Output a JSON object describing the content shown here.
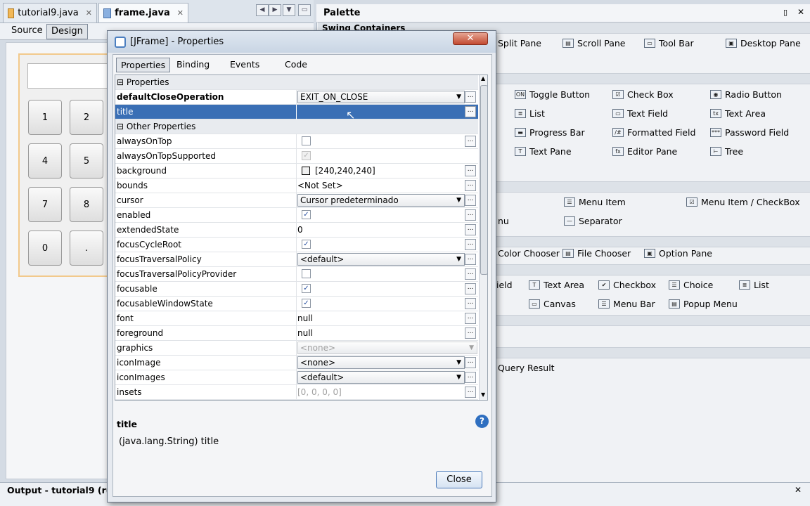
{
  "editor": {
    "tabs": [
      {
        "label": "tutorial9.java"
      },
      {
        "label": "frame.java"
      }
    ],
    "source_label": "Source",
    "design_label": "Design"
  },
  "calculator": {
    "buttons": [
      "1",
      "2",
      "4",
      "5",
      "7",
      "8",
      "0",
      "."
    ]
  },
  "palette": {
    "title": "Palette",
    "section_swing_containers": "Swing Containers",
    "items": [
      "Split Pane",
      "Scroll Pane",
      "Tool Bar",
      "Desktop Pane",
      "Toggle Button",
      "Check Box",
      "Radio Button",
      "List",
      "Text Field",
      "Text Area",
      "Progress Bar",
      "Formatted Field",
      "Password Field",
      "Text Pane",
      "Editor Pane",
      "Tree",
      "Menu Item",
      "Menu Item / CheckBox",
      "nu",
      "Separator",
      "Color Chooser",
      "File Chooser",
      "Option Pane",
      "ield",
      "Text Area",
      "Checkbox",
      "Choice",
      "List",
      "Canvas",
      "Menu Bar",
      "Popup Menu",
      "Query Result"
    ]
  },
  "output": {
    "title": "Output - tutorial9 (ru"
  },
  "dialog": {
    "title": "[JFrame] - Properties",
    "tabs": [
      "Properties",
      "Binding",
      "Events",
      "Code"
    ],
    "cat_properties": "Properties",
    "cat_other": "Other Properties",
    "props": [
      {
        "name": "defaultCloseOperation",
        "value": "EXIT_ON_CLOSE"
      },
      {
        "name": "title",
        "value": ""
      },
      {
        "name": "alwaysOnTop",
        "value": ""
      },
      {
        "name": "alwaysOnTopSupported",
        "value": ""
      },
      {
        "name": "background",
        "value": "[240,240,240]"
      },
      {
        "name": "bounds",
        "value": "<Not Set>"
      },
      {
        "name": "cursor",
        "value": "Cursor predeterminado"
      },
      {
        "name": "enabled",
        "value": ""
      },
      {
        "name": "extendedState",
        "value": "0"
      },
      {
        "name": "focusCycleRoot",
        "value": ""
      },
      {
        "name": "focusTraversalPolicy",
        "value": "<default>"
      },
      {
        "name": "focusTraversalPolicyProvider",
        "value": ""
      },
      {
        "name": "focusable",
        "value": ""
      },
      {
        "name": "focusableWindowState",
        "value": ""
      },
      {
        "name": "font",
        "value": "null"
      },
      {
        "name": "foreground",
        "value": "null"
      },
      {
        "name": "graphics",
        "value": "<none>"
      },
      {
        "name": "iconImage",
        "value": "<none>"
      },
      {
        "name": "iconImages",
        "value": "<default>"
      },
      {
        "name": "insets",
        "value": "[0, 0, 0, 0]"
      }
    ],
    "desc_title": "title",
    "desc_text": "(java.lang.String) title",
    "close_label": "Close",
    "help_label": "?",
    "dots_label": "..."
  }
}
